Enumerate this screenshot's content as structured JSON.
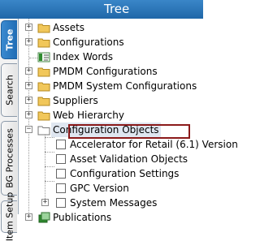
{
  "header": {
    "title": "Tree"
  },
  "tabs": [
    {
      "label": "Tree",
      "active": true
    },
    {
      "label": "Search"
    },
    {
      "label": "BG Processes"
    },
    {
      "label": "Item Setup"
    }
  ],
  "tree": {
    "items": [
      {
        "label": "Assets",
        "icon": "folder-icon"
      },
      {
        "label": "Configurations",
        "icon": "folder-icon"
      },
      {
        "label": "Index Words",
        "icon": "index-icon"
      },
      {
        "label": "PMDM Configurations",
        "icon": "folder-icon"
      },
      {
        "label": "PMDM System Configurations",
        "icon": "folder-icon"
      },
      {
        "label": "Suppliers",
        "icon": "folder-icon"
      },
      {
        "label": "Web Hierarchy",
        "icon": "folder-icon"
      },
      {
        "label": "Configuration Objects",
        "icon": "folder-open-icon",
        "selected": true
      },
      {
        "label": "Accelerator for Retail (6.1) Version",
        "icon": "page-icon"
      },
      {
        "label": "Asset Validation Objects",
        "icon": "page-icon",
        "highlighted": true
      },
      {
        "label": "Configuration Settings",
        "icon": "page-icon"
      },
      {
        "label": "GPC Version",
        "icon": "page-icon"
      },
      {
        "label": "System Messages",
        "icon": "page-icon"
      },
      {
        "label": "Publications",
        "icon": "publications-icon"
      }
    ]
  },
  "colors": {
    "header": "#2b77bb",
    "highlight_border": "#8b1a1a",
    "folder": "#f1c75a"
  }
}
